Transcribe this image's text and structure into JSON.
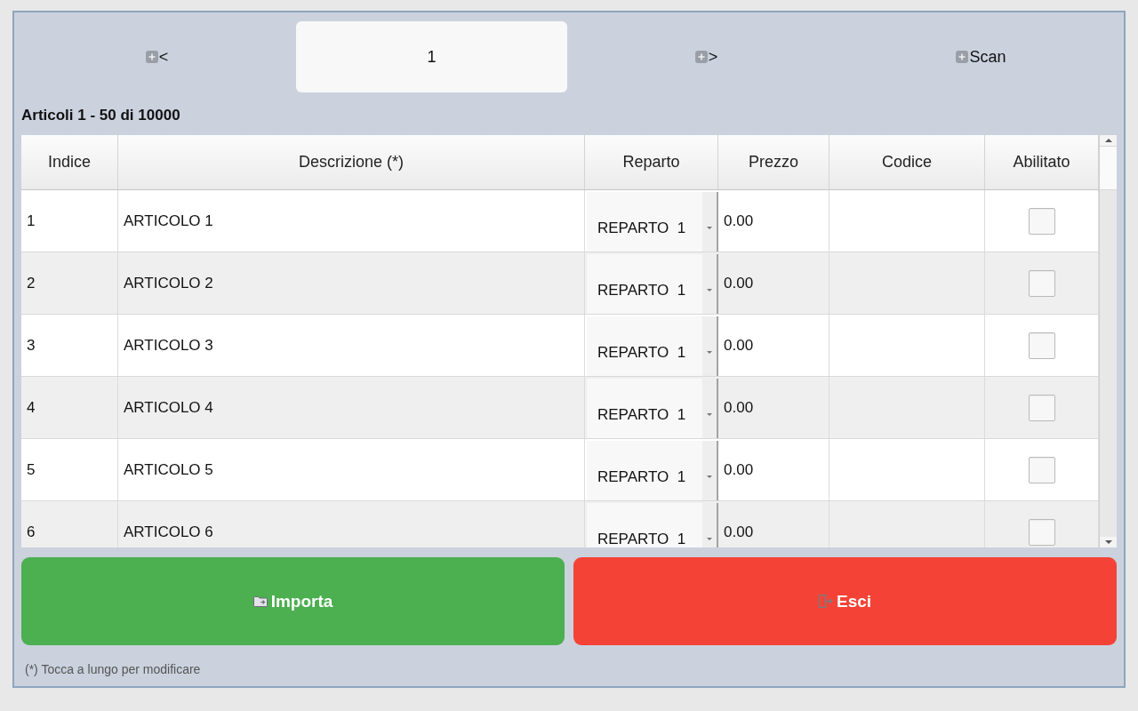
{
  "toolbar": [
    {
      "kind": "button",
      "label": "<"
    },
    {
      "kind": "field",
      "value": "1"
    },
    {
      "kind": "button",
      "label": ">"
    },
    {
      "kind": "button",
      "label": "Scan"
    }
  ],
  "summary": "Articoli 1 - 50 di 10000",
  "table": {
    "columns": [
      "Indice",
      "Descrizione (*)",
      "Reparto",
      "Prezzo",
      "Codice",
      "Abilitato"
    ],
    "rows": [
      {
        "index": "1",
        "description": "ARTICOLO 1",
        "department": "REPARTO  1",
        "price": "0.00",
        "enabled": false
      },
      {
        "index": "2",
        "description": "ARTICOLO 2",
        "department": "REPARTO  1",
        "price": "0.00",
        "enabled": false
      },
      {
        "index": "3",
        "description": "ARTICOLO 3",
        "department": "REPARTO  1",
        "price": "0.00",
        "enabled": false
      },
      {
        "index": "4",
        "description": "ARTICOLO 4",
        "department": "REPARTO  1",
        "price": "0.00",
        "enabled": false
      },
      {
        "index": "5",
        "description": "ARTICOLO 5",
        "department": "REPARTO  1",
        "price": "0.00",
        "enabled": false
      },
      {
        "index": "6",
        "description": "ARTICOLO 6",
        "department": "REPARTO  1",
        "price": "0.00",
        "enabled": false
      }
    ]
  },
  "actions": [
    {
      "kind": "import",
      "label": "Importa"
    },
    {
      "kind": "exit",
      "label": "Esci"
    }
  ],
  "footnote": "(*) Tocca a lungo per modificare"
}
